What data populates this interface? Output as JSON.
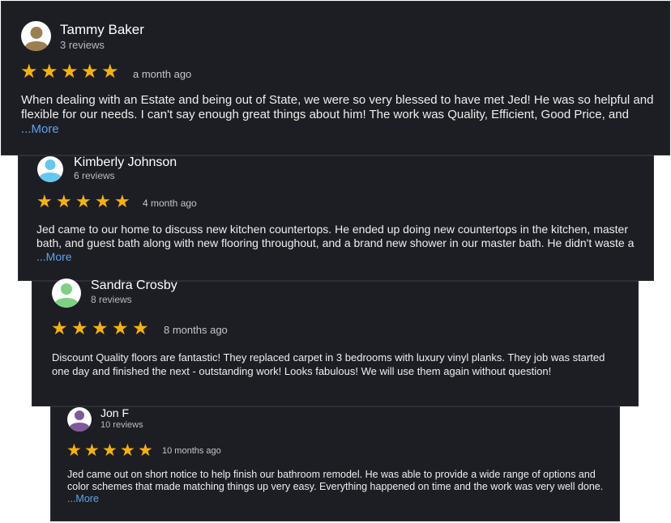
{
  "reviews": [
    {
      "name": "Tammy Baker",
      "count": "3 reviews",
      "time": "a month ago",
      "text": "When dealing with an Estate and being out of State, we were so very blessed to have met Jed! He was so helpful and flexible for our needs. I can't say enough great things about him! The work was Quality, Efficient, Good Price, and ",
      "more": "...More",
      "rating": 5,
      "avatar_color": "#9c7e4f"
    },
    {
      "name": "Kimberly Johnson",
      "count": "6 reviews",
      "time": "4 month ago",
      "text": "Jed came to our home to discuss new kitchen countertops. He ended up doing new countertops in the kitchen, master bath, and guest bath along with new flooring throughout, and a brand new shower in our master bath. He didn't waste a ",
      "more": "...More",
      "rating": 5,
      "avatar_color": "#63c8ef"
    },
    {
      "name": "Sandra Crosby",
      "count": "8 reviews",
      "time": "8 months ago",
      "text": "Discount Quality floors are fantastic! They replaced carpet in 3 bedrooms with luxury vinyl planks. They job was started one day and finished the next - outstanding work! Looks fabulous! We will use them again without question!",
      "rating": 5,
      "avatar_color": "#7ed082"
    },
    {
      "name": "Jon F",
      "count": "10 reviews",
      "time": "10 months ago",
      "text": "Jed came out on short notice to help finish our bathroom remodel. He was able to provide a wide range of options and color schemes that made matching things up very easy. Everything happened on time and the work was very well done. ",
      "more": "...More",
      "rating": 5,
      "avatar_color": "#7e5a9b"
    }
  ],
  "star_glyph": "★",
  "star_color": "#f6b20a",
  "link_color": "#5ea3ea"
}
